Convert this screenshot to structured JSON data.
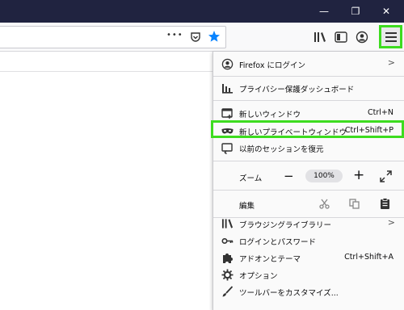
{
  "window": {
    "minimize_glyph": "—",
    "maximize_glyph": "❐",
    "close_glyph": "✕"
  },
  "toolbar": {
    "more_glyph": "•••",
    "pocket_icon": "pocket-icon",
    "bookmark_star_icon": "star-icon",
    "library_icon": "library-icon",
    "sidebar_icon": "sidebar-icon",
    "account_icon": "account-icon",
    "menu_icon": "hamburger-icon"
  },
  "menu": {
    "firefox_login": "Firefox にログイン",
    "privacy_dashboard": "プライバシー保護ダッシュボード",
    "new_window": "新しいウィンドウ",
    "new_window_shortcut": "Ctrl+N",
    "new_private_window": "新しいプライベートウィンドウ",
    "new_private_window_shortcut": "Ctrl+Shift+P",
    "restore_session": "以前のセッションを復元",
    "zoom_label": "ズーム",
    "zoom_out": "−",
    "zoom_value": "100%",
    "zoom_in": "+",
    "edit_label": "編集",
    "library": "ブラウジングライブラリー",
    "logins": "ログインとパスワード",
    "addons": "アドオンとテーマ",
    "addons_shortcut": "Ctrl+Shift+A",
    "options": "オプション",
    "customize": "ツールバーをカスタマイズ..."
  },
  "colors": {
    "titlebar": "#202340",
    "highlight": "#3ddc1f",
    "accent_blue": "#0a84ff"
  }
}
